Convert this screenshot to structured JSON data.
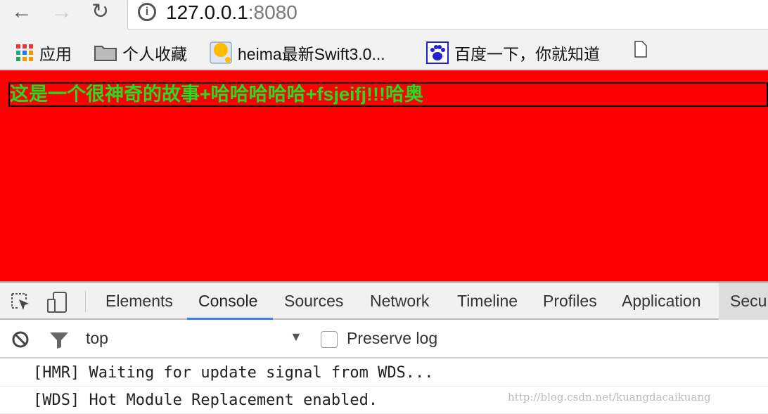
{
  "browser": {
    "url_host": "127.0.0.1",
    "url_port": ":8080"
  },
  "bookmarks": [
    {
      "label": "应用",
      "icon": "apps-grid-icon"
    },
    {
      "label": "个人收藏",
      "icon": "folder-icon"
    },
    {
      "label": "heima最新Swift3.0...",
      "icon": "bookmark-favicon-icon"
    },
    {
      "label": "百度一下，你就知道",
      "icon": "baidu-paw-icon"
    },
    {
      "label": "",
      "icon": "document-icon"
    }
  ],
  "page": {
    "text": "这是一个很神奇的故事+哈哈哈哈哈+fsjeifj!!!哈奥",
    "background": "#ff0000",
    "text_color": "#22dd22"
  },
  "devtools": {
    "tabs": [
      "Elements",
      "Console",
      "Sources",
      "Network",
      "Timeline",
      "Profiles",
      "Application",
      "Secu"
    ],
    "active_tab": "Console",
    "context": "top",
    "preserve_log": "Preserve log",
    "messages": [
      "[HMR] Waiting for update signal from WDS...",
      "[WDS] Hot Module Replacement enabled."
    ]
  },
  "watermark": "http://blog.csdn.net/kuangdacaikuang"
}
